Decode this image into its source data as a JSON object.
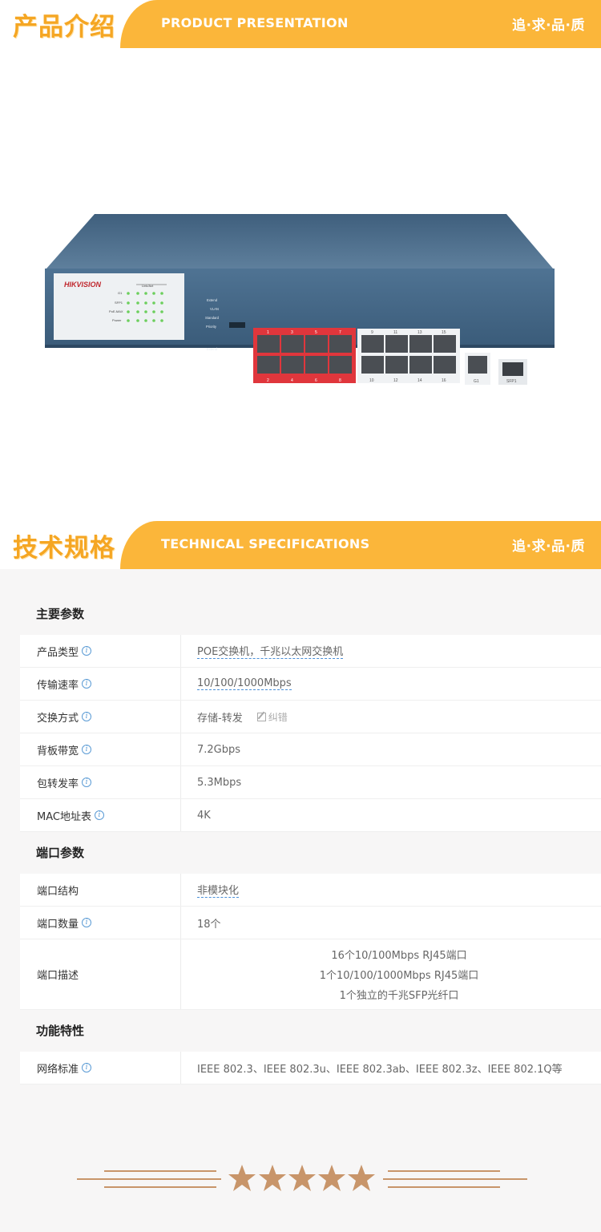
{
  "banner1": {
    "cn_title": "产品介绍",
    "en_title": "PRODUCT PRESENTATION",
    "slogan": "追·求·品·质"
  },
  "banner2": {
    "cn_title": "技术规格",
    "en_title": "TECHNICAL SPECIFICATIONS",
    "slogan": "追·求·品·质"
  },
  "product": {
    "brand": "HIKVISION",
    "front_labels": [
      "G1",
      "SFP1",
      "PoE-MAX",
      "Power"
    ],
    "top_port_numbers": [
      "1",
      "3",
      "5",
      "7",
      "9",
      "11",
      "13",
      "15"
    ],
    "bottom_port_numbers": [
      "2",
      "4",
      "6",
      "8",
      "10",
      "12",
      "14",
      "16"
    ],
    "mode_labels": [
      "Extend",
      "VLAN",
      "Standard",
      "Priority"
    ],
    "uplink_labels": [
      "G1",
      "SFP1"
    ],
    "led_header": "Link/Act"
  },
  "specs": {
    "main": {
      "title": "主要参数",
      "rows": [
        {
          "key": "产品类型",
          "value": "POE交换机，千兆以太网交换机"
        },
        {
          "key": "传输速率",
          "value": "10/100/1000Mbps"
        },
        {
          "key": "交换方式",
          "value": "存储-转发",
          "action": "纠错"
        },
        {
          "key": "背板带宽",
          "value": "7.2Gbps"
        },
        {
          "key": "包转发率",
          "value": "5.3Mbps"
        },
        {
          "key": "MAC地址表",
          "value": "4K"
        }
      ]
    },
    "ports": {
      "title": "端口参数",
      "rows": [
        {
          "key": "端口结构",
          "value": "非模块化"
        },
        {
          "key": "端口数量",
          "value": "18个"
        },
        {
          "key": "端口描述",
          "lines": [
            "16个10/100Mbps RJ45端口",
            "1个10/100/1000Mbps RJ45端口",
            "1个独立的千兆SFP光纤口"
          ]
        }
      ]
    },
    "features": {
      "title": "功能特性",
      "rows": [
        {
          "key": "网络标准",
          "value": "IEEE 802.3、IEEE 802.3u、IEEE 802.3ab、IEEE 802.3z、IEEE 802.1Q等"
        }
      ]
    }
  },
  "colors": {
    "accent": "#fbb63a",
    "title_orange": "#f5a623",
    "link_blue": "#4a90d9",
    "star_gold": "#c8956a"
  }
}
